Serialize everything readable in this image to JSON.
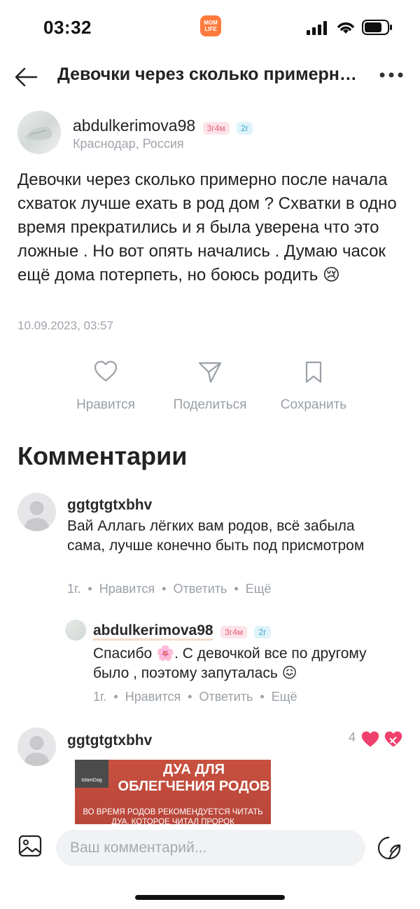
{
  "status_bar": {
    "time": "03:32",
    "app_logo_text": "MOM LIFE"
  },
  "header": {
    "title": "Девочки через сколько примерно после начала схваток лучше ехать в род дом ?"
  },
  "post": {
    "author": "abdulkerimova98",
    "badges": [
      "3г4м",
      "2г"
    ],
    "location": "Краснодар, Россия",
    "text": "Девочки через сколько примерно после начала схваток лучше ехать в род дом ? Схватки в одно время прекратились и я была уверена что это ложные . Но вот опять начались . Думаю часок ещё дома потерпеть, но боюсь родить 😢",
    "date": "10.09.2023, 03:57",
    "actions": {
      "like": "Нравится",
      "share": "Поделиться",
      "save": "Сохранить"
    }
  },
  "comments_title": "Комментарии",
  "comments": [
    {
      "author": "ggtgtgtxbhv",
      "text": "Вай Аллагь лёгких вам родов, всё забыла сама, лучше конечно быть под присмотром",
      "age": "1г.",
      "like": "Нравится",
      "reply": "Ответить",
      "more": "Ещё",
      "reply_item": {
        "author": "abdulkerimova98",
        "badges": [
          "3г4м",
          "2г"
        ],
        "text": "Спасибо 🌸. С девочкой все по другому было , поэтому запуталась 😖",
        "age": "1г.",
        "like": "Нравится",
        "reply": "Ответить",
        "more": "Ещё"
      }
    },
    {
      "author": "ggtgtgtxbhv",
      "likes": "4",
      "image": {
        "brand": "IslamDag",
        "title_line1": "ДУА ДЛЯ",
        "title_line2": "ОБЛЕГЧЕНИЯ РОДОВ",
        "subtitle": "ВО ВРЕМЯ РОДОВ РЕКОМЕНДУЕТСЯ ЧИТАТЬ ДУА, КОТОРОЕ ЧИТАЛ ПРОРОК"
      }
    }
  ],
  "composer": {
    "placeholder": "Ваш комментарий..."
  },
  "colors": {
    "accent_pink": "#f0416c",
    "meta_grey": "#9aa0a6"
  }
}
